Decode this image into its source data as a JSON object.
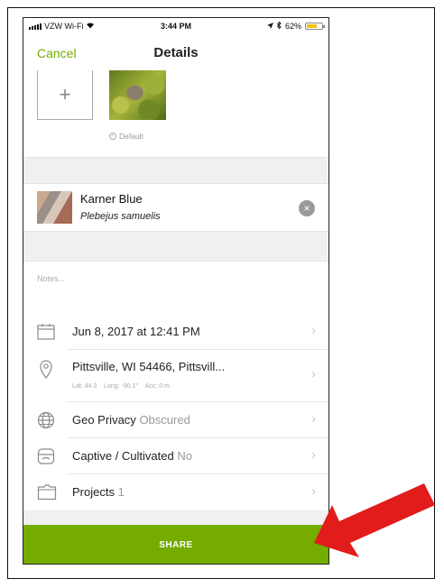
{
  "status_bar": {
    "carrier": "VZW Wi-Fi",
    "time": "3:44 PM",
    "battery": "62%"
  },
  "nav": {
    "cancel_label": "Cancel",
    "title": "Details"
  },
  "photos": {
    "add_label": "+",
    "default_label": "Default"
  },
  "species": {
    "common_name": "Karner Blue",
    "scientific_name": "Plebejus samuelis",
    "clear_label": "×"
  },
  "notes": {
    "placeholder": "Notes..."
  },
  "details": {
    "date": {
      "text": "Jun 8, 2017 at 12:41 PM"
    },
    "location": {
      "text": "Pittsville, WI  54466, Pittsvill...",
      "lat": "Lat: 44.3",
      "long": "Long: -90.1°",
      "acc": "Acc: 0 m"
    },
    "geo_privacy": {
      "label": "Geo Privacy",
      "value": "Obscured"
    },
    "captive": {
      "label": "Captive / Cultivated",
      "value": "No"
    },
    "projects": {
      "label": "Projects",
      "value": "1"
    }
  },
  "share": {
    "label": "SHARE"
  },
  "chevron": "›",
  "colors": {
    "accent_green": "#74ac00",
    "arrow_red": "#e21b1b"
  }
}
